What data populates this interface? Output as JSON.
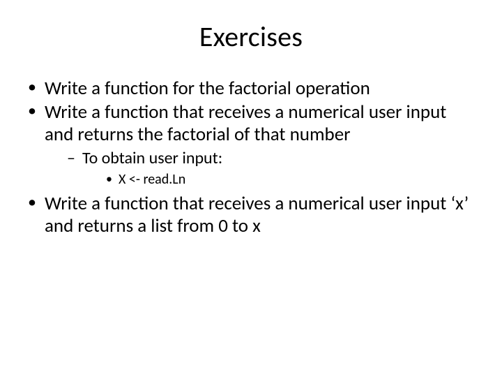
{
  "title": "Exercises",
  "bullets": {
    "b0": "Write a function for the factorial operation",
    "b1": "Write a function that receives a numerical user input and returns the factorial of that number",
    "b1_sub0": "To obtain user input:",
    "b1_sub0_sub0": "X <- read.Ln",
    "b2": "Write a function that receives a numerical user input ‘x’ and returns a list from 0 to x"
  }
}
